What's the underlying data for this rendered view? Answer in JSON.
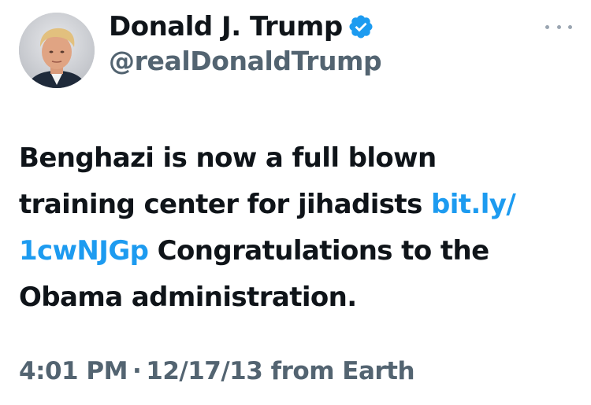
{
  "author": {
    "display_name": "Donald J. Trump",
    "handle": "@realDonaldTrump",
    "verified": true,
    "verified_color": "#1d9bf0"
  },
  "icons": {
    "avatar": "profile-photo",
    "verified": "verified-check-icon",
    "more": "more-options-icon"
  },
  "tweet": {
    "text_lines": [
      [
        {
          "type": "text",
          "value": "Benghazi is now a full blown"
        }
      ],
      [
        {
          "type": "text",
          "value": "training center for jihadists "
        },
        {
          "type": "link",
          "value": "bit.ly/"
        }
      ],
      [
        {
          "type": "link",
          "value": "1cwNJGp"
        },
        {
          "type": "text",
          "value": " Congratulations to the"
        }
      ],
      [
        {
          "type": "text",
          "value": "Obama administration."
        }
      ]
    ]
  },
  "meta": {
    "time": "4:01 PM",
    "separator": "·",
    "date": "12/17/13",
    "source": "from Earth"
  },
  "colors": {
    "text": "#0f1419",
    "secondary": "#536471",
    "link": "#1d9bf0"
  }
}
